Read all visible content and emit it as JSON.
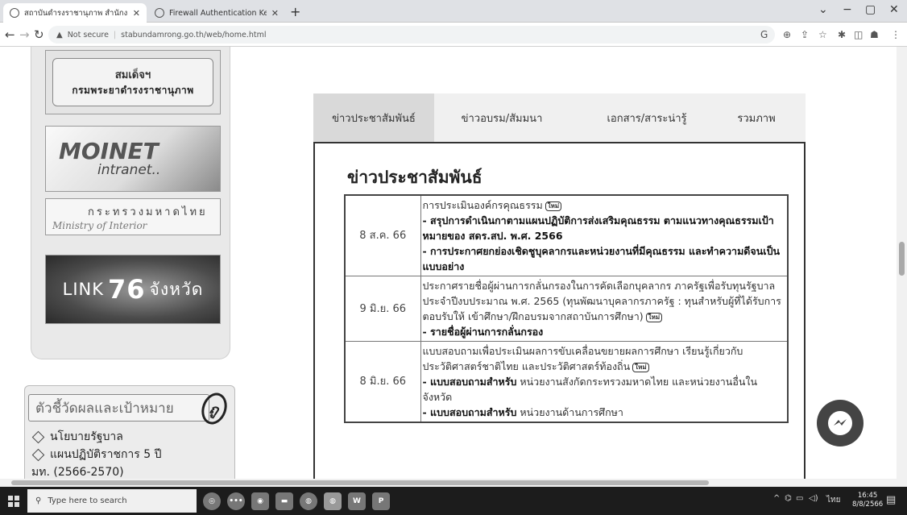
{
  "browser": {
    "tabs": [
      {
        "label": "สถาบันดำรงราชานุภาพ สำนักงานปลัด"
      },
      {
        "label": "Firewall Authentication Keepaliv"
      }
    ],
    "new_tab": "+",
    "window_controls": {
      "minimize": "−",
      "maximize": "▢",
      "close": "✕",
      "menu": "⌄"
    },
    "security_label": "Not secure",
    "url": "stabundamrong.go.th/web/home.html"
  },
  "sidebar": {
    "banner1": {
      "line1": "สมเด็จฯ",
      "line2": "กรมพระยาดำรงราชานุภาพ"
    },
    "banner2": {
      "line1": "MOINET",
      "line2": "intranet.."
    },
    "banner3": {
      "line1": "กระทรวงมหาดไทย",
      "line2": "Ministry of Interior"
    },
    "banner4": {
      "pre": "LINK",
      "num": "76",
      "post": "จังหวัด"
    },
    "kpi_title": "ตัวชี้วัดผลและเป้าหมาย",
    "kpi_badge": "ถู",
    "links": [
      "นโยบายรัฐบาล",
      "แผนปฏิบัติราชการ 5 ปี",
      "มท. (2566-2570)"
    ]
  },
  "content": {
    "tabs": [
      "ข่าวประชาสัมพันธ์",
      "ข่าวอบรม/สัมมนา",
      "เอกสาร/สาระน่ารู้",
      "รวมภาพ"
    ],
    "panel_title": "ข่าวประชาสัมพันธ์",
    "new_badge": "ใหม่",
    "rows": [
      {
        "date": "8 ส.ค. 66",
        "intro": "การประเมินองค์กรคุณธรรม",
        "items": [
          "- สรุปการดำเนินกาตามแผนปฏิบัติการส่งเสริมคุณธรรม ตามแนวทางคุณธรรมเป้าหมายของ สดร.สป. พ.ศ. 2566",
          "- การประกาศยกย่องเชิดชูบุคลากรและหน่วยงานที่มีคุณธรรม และทำความดีจนเป็นแบบอย่าง"
        ]
      },
      {
        "date": "9 มิ.ย. 66",
        "intro": "ประกาศรายชื่อผู้ผ่านการกลั่นกรองในการคัดเลือกบุคลากร ภาครัฐเพื่อรับทุนรัฐบาล ประจำปีงบประมาณ พ.ศ. 2565 (ทุนพัฒนาบุคลากรภาครัฐ : ทุนสำหรับผู้ที่ได้รับการตอบรับให้ เข้าศึกษา/ฝึกอบรมจากสถาบันการศึกษา)",
        "items": [
          "- รายชื่อผู้ผ่านการกลั่นกรอง"
        ]
      },
      {
        "date": "8 มิ.ย. 66",
        "intro": "แบบสอบถามเพื่อประเมินผลการขับเคลื่อนขยายผลการศึกษา เรียนรู้เกี่ยวกับประวัติศาสตร์ชาติไทย และประวัติศาสตร์ท้องถิ่น",
        "survey1_label": "- แบบสอบถามสำหรับ",
        "survey1_text": "หน่วยงานสังกัดกระทรวงมหาดไทย และหน่วยงานอื่นในจังหวัด",
        "survey2_label": "- แบบสอบถามสำหรับ",
        "survey2_text": "หน่วยงานด้านการศึกษา"
      }
    ]
  },
  "taskbar": {
    "search_placeholder": "Type here to search",
    "tray_language": "ไทย",
    "time": "16:45",
    "date": "8/8/2566"
  },
  "colors": {
    "tab_active_bg": "#d9d9d9",
    "panel_border": "#333333",
    "taskbar_bg": "#1c1c1c"
  }
}
